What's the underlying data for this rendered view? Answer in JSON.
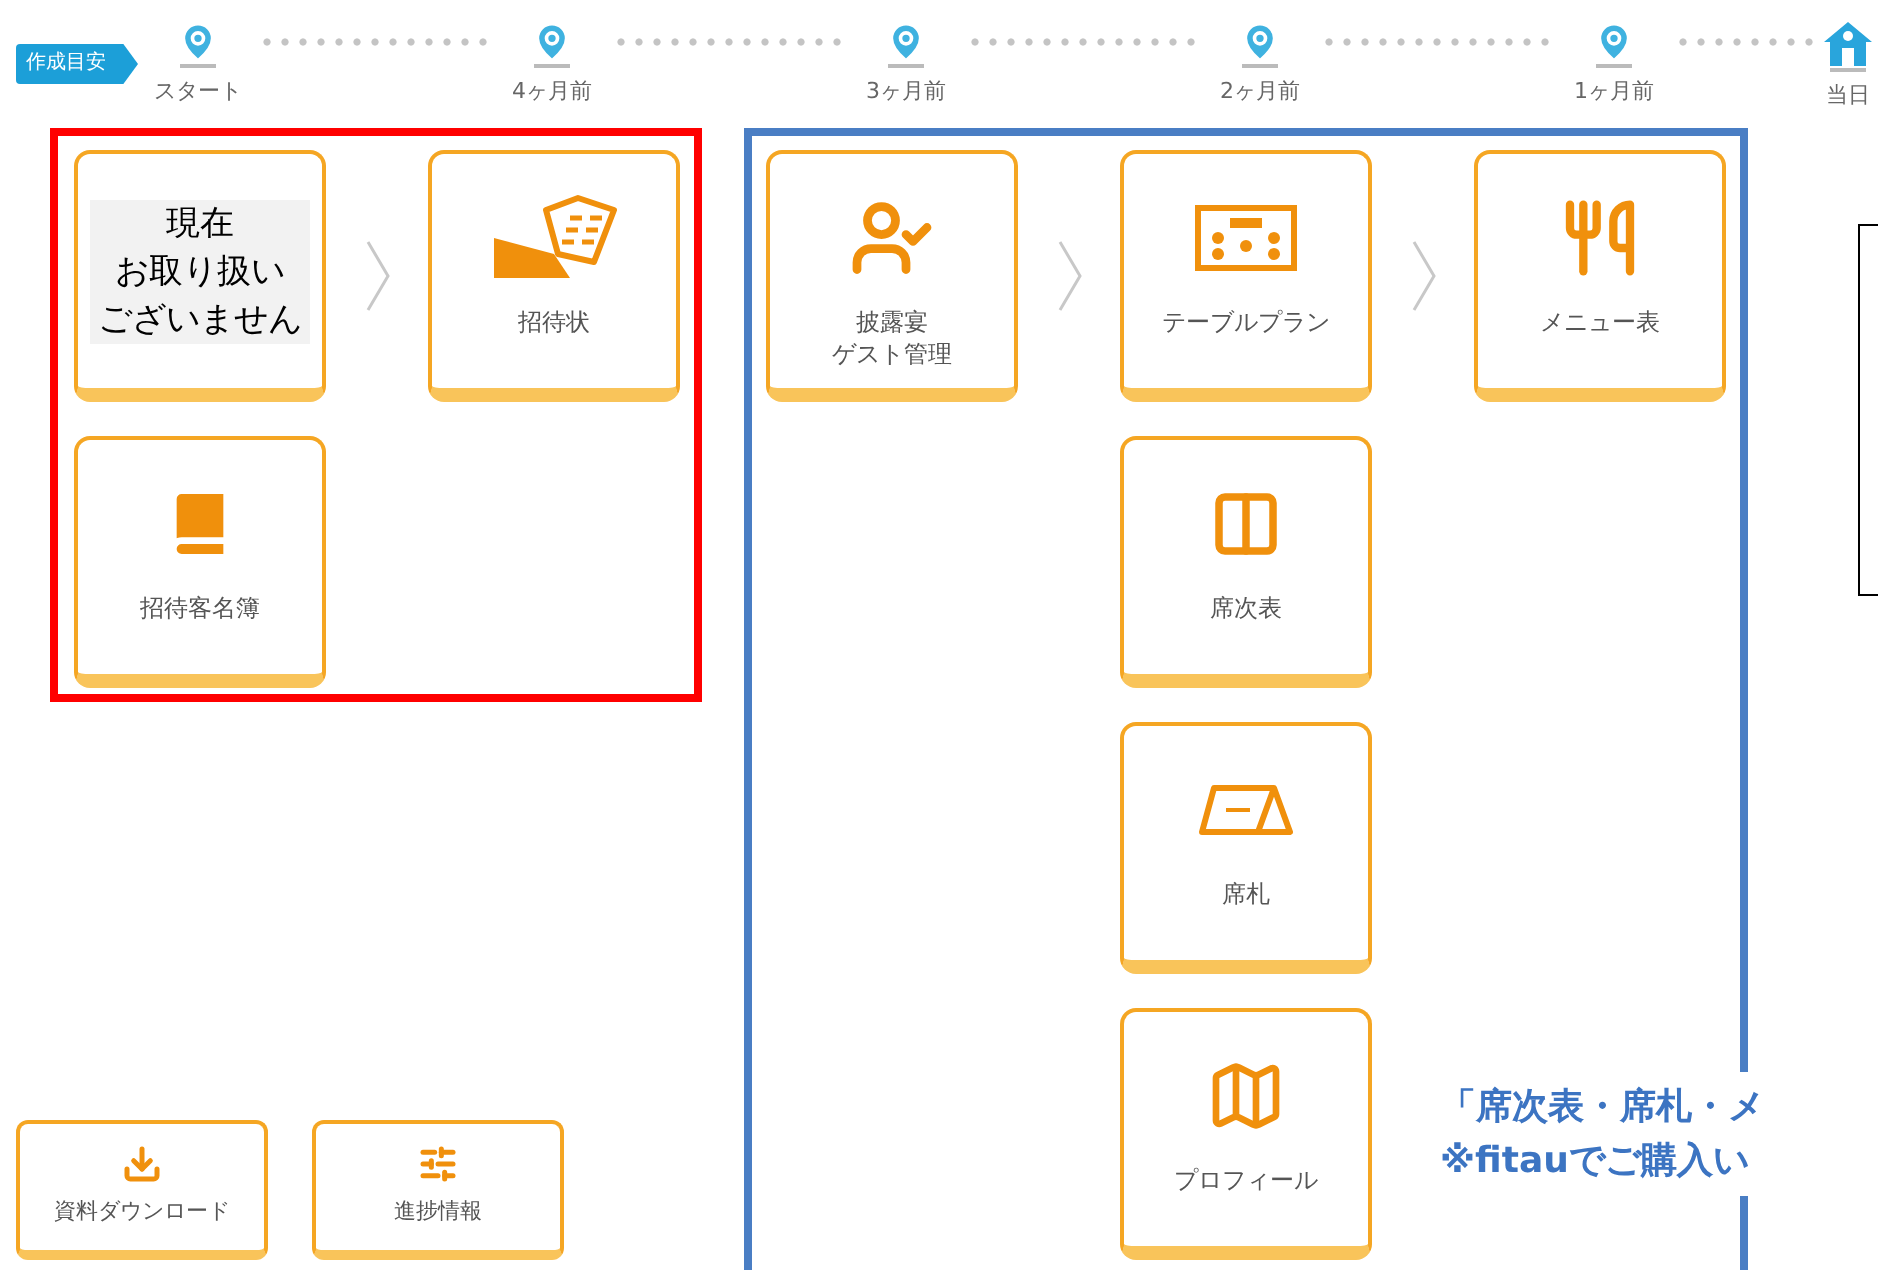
{
  "timeline": {
    "badge": "作成目安",
    "milestones": [
      {
        "label": "スタート",
        "kind": "pin"
      },
      {
        "label": "4ヶ月前",
        "kind": "pin"
      },
      {
        "label": "3ヶ月前",
        "kind": "pin"
      },
      {
        "label": "2ヶ月前",
        "kind": "pin"
      },
      {
        "label": "1ヶ月前",
        "kind": "pin"
      },
      {
        "label": "当日",
        "kind": "venue"
      }
    ]
  },
  "groups": [
    {
      "color": "#ff0000",
      "columns": [
        [
          {
            "kind": "unavailable",
            "notice": [
              "現在",
              "お取り扱い",
              "ございません"
            ]
          },
          {
            "kind": "card",
            "label": [
              "招待客名簿"
            ]
          }
        ],
        [
          {
            "kind": "card",
            "label": [
              "招待状"
            ]
          }
        ]
      ]
    },
    {
      "color": "#4a7ec4",
      "columns": [
        [
          {
            "kind": "card",
            "label": [
              "披露宴",
              "ゲスト管理"
            ]
          }
        ],
        [
          {
            "kind": "card",
            "label": [
              "テーブルプラン"
            ]
          },
          {
            "kind": "card",
            "label": [
              "席次表"
            ]
          },
          {
            "kind": "card",
            "label": [
              "席札"
            ]
          },
          {
            "kind": "card",
            "label": [
              "プロフィール"
            ]
          }
        ],
        [
          {
            "kind": "card",
            "label": [
              "メニュー表"
            ]
          }
        ]
      ]
    }
  ],
  "tools": [
    {
      "label": "資料ダウンロード"
    },
    {
      "label": "進捗情報"
    }
  ],
  "note": {
    "lines": [
      "「席次表・席札・メ",
      "※fitauでご購入い"
    ]
  }
}
